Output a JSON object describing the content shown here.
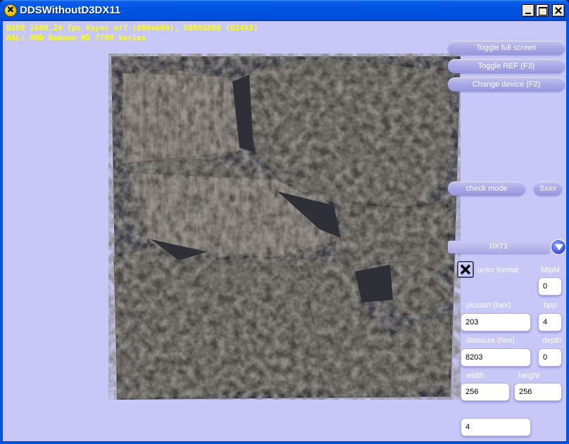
{
  "window": {
    "title": "DDSWithoutD3DX11",
    "icon": "app-icon"
  },
  "stats": {
    "line1": "D3D9 1680.24 fps Vsync off (800x600), X8R8G8B8 (D24X8)",
    "line2": "HAL: AMD Radeon HD 7700 Series"
  },
  "buttons": {
    "toggle_full_screen": "Toggle full screen",
    "toggle_ref": "Toggle REF (F3)",
    "change_device": "Change device (F2)",
    "check_mode": "check mode",
    "sxxx": "Sxxx"
  },
  "format_dropdown": {
    "selected": "DXT1"
  },
  "unkn_format": {
    "label": "unkn format",
    "checked": true
  },
  "fields": {
    "mipm": {
      "label": "MipM",
      "value": "0"
    },
    "picstart": {
      "label": "picstart  (hex)",
      "value": "203"
    },
    "bpp": {
      "label": "bpp",
      "value": "4"
    },
    "datasize": {
      "label": "datasize  (hex)",
      "value": "8203"
    },
    "depth": {
      "label": "depth",
      "value": "0"
    },
    "width": {
      "label": "width",
      "value": "256"
    },
    "height": {
      "label": "height",
      "value": "256"
    },
    "extra": {
      "value": "4"
    }
  },
  "colors": {
    "client_bg": "#c8c8f8",
    "stats_text": "#ffff00",
    "title_bar": "#0054e3"
  }
}
